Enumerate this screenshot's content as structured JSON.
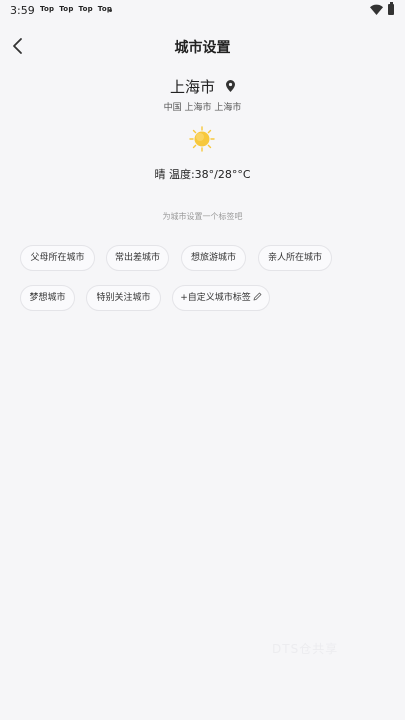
{
  "status_bar": {
    "time": "3:59",
    "notifications": [
      "Top",
      "Top",
      "Top",
      "Top"
    ]
  },
  "header": {
    "title": "城市设置"
  },
  "city": {
    "name": "上海市",
    "path": "中国 上海市 上海市"
  },
  "weather": {
    "icon": "sun-icon",
    "text": "晴 温度:38°/28°°C"
  },
  "hint": "为城市设置一个标签吧",
  "tags": [
    {
      "label": "父母所在城市"
    },
    {
      "label": "常出差城市"
    },
    {
      "label": "想旅游城市"
    },
    {
      "label": "亲人所在城市"
    },
    {
      "label": "梦想城市"
    },
    {
      "label": "特别关注城市"
    },
    {
      "label": "+自定义城市标签"
    }
  ],
  "watermark": "DTS仓共享",
  "colors": {
    "background": "#f6f6f8",
    "sun": "#f7c83c",
    "tag_border": "#e4e4e8"
  }
}
